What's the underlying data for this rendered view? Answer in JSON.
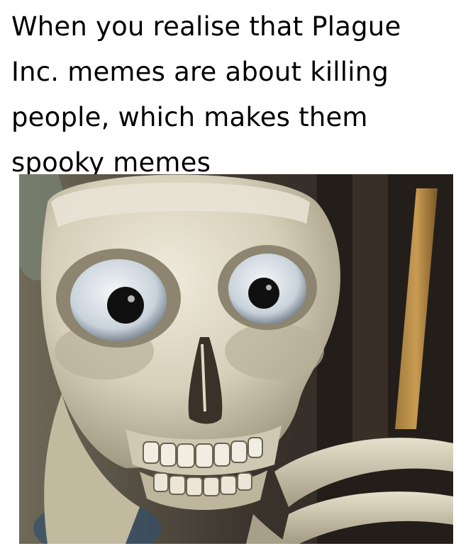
{
  "caption": {
    "lines": [
      "When you realise that Plague",
      "Inc. memes are about killing",
      "people, which makes them",
      "spooky memes"
    ]
  },
  "photo": {
    "subject_icon": "skeleton-skull-icon"
  },
  "colors": {
    "background": "#ffffff",
    "text": "#000000",
    "bone": "#d8d2bf",
    "backdrop_dark": "#2a2622"
  }
}
